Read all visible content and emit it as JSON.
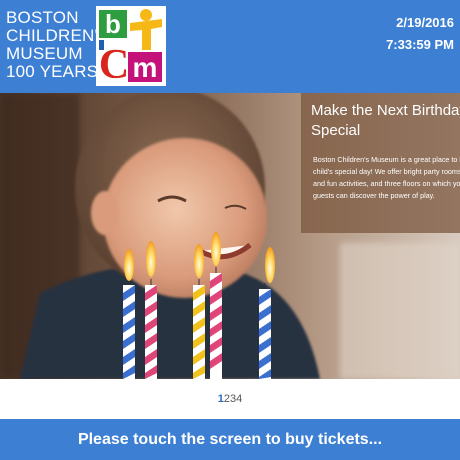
{
  "header": {
    "brand_lines": [
      "BOSTON",
      "CHILDREN'S",
      "MUSEUM",
      "100 YEARS"
    ],
    "logo": {
      "letters": [
        "b",
        "C",
        "m"
      ]
    },
    "date": "2/19/2016",
    "time": "7:33:59 PM"
  },
  "hero": {
    "image": "birthday-child-with-candles",
    "promo": {
      "title": "Make the Next Birthday Special",
      "body": "Boston Children's Museum is a great place to host your child's special day! We offer bright party rooms, educational and fun activities, and three floors on which you and your guests can discover the power of play."
    }
  },
  "pager": {
    "pages": [
      "1",
      "2",
      "3",
      "4"
    ],
    "active": "1"
  },
  "footer": {
    "cta": "Please touch the screen to buy tickets..."
  },
  "colors": {
    "brand_blue": "#3d7fd3",
    "logo_green": "#2e9d3f",
    "logo_red": "#d9261c",
    "logo_magenta": "#c4127a",
    "logo_yellow": "#f6b816",
    "logo_blue": "#1f5fb0"
  }
}
